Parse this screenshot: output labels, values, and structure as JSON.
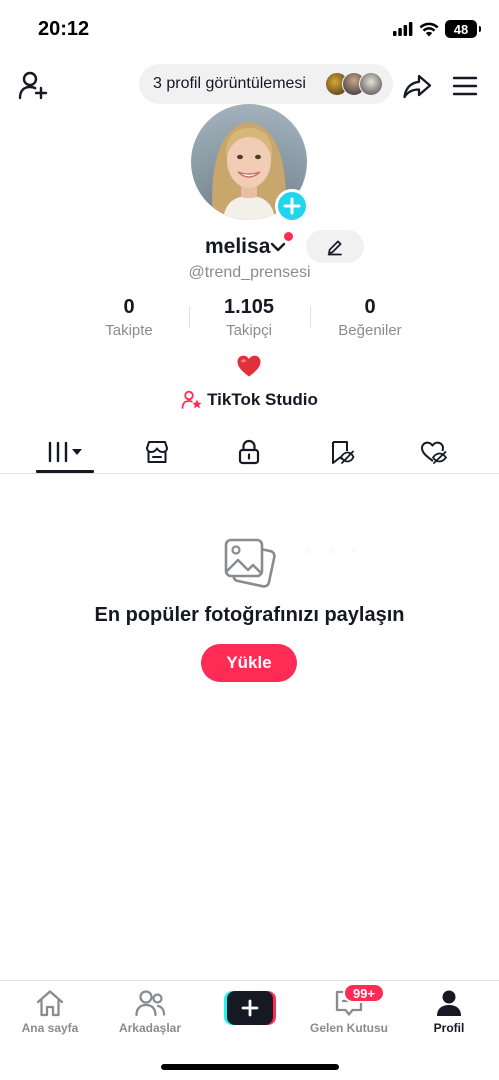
{
  "status_bar": {
    "time": "20:12",
    "battery": "48",
    "icons": [
      "signal-icon",
      "wifi-icon",
      "battery-icon"
    ]
  },
  "top_bar": {
    "profile_views": "3 profil görüntülemesi",
    "icons": [
      "add-friend-icon",
      "share-icon",
      "menu-icon"
    ]
  },
  "profile": {
    "username": "melisa",
    "handle": "@trend_prensesi",
    "stats": [
      {
        "value": "0",
        "label": "Takipte"
      },
      {
        "value": "1.105",
        "label": "Takipçi"
      },
      {
        "value": "0",
        "label": "Beğeniler"
      }
    ],
    "bio": "❤️",
    "studio_link": "TikTok Studio"
  },
  "tabs": [
    "videos-grid",
    "shop",
    "private",
    "saved",
    "liked"
  ],
  "empty_state": {
    "title": "En popüler fotoğrafınızı paylaşın",
    "button": "Yükle"
  },
  "bottom_nav": {
    "items": [
      {
        "label": "Ana sayfa",
        "icon": "home-icon"
      },
      {
        "label": "Arkadaşlar",
        "icon": "friends-icon"
      },
      {
        "label": "",
        "icon": "create-icon"
      },
      {
        "label": "Gelen Kutusu",
        "icon": "inbox-icon"
      },
      {
        "label": "Profil",
        "icon": "profile-icon"
      }
    ],
    "inbox_badge": "99+",
    "active": "Profil"
  },
  "colors": {
    "accent": "#fe2c55",
    "cyan": "#25f4ee",
    "add_badge": "#20d5ec",
    "text": "#161823",
    "muted": "#8a8b91",
    "pill_bg": "#f1f1f2"
  }
}
